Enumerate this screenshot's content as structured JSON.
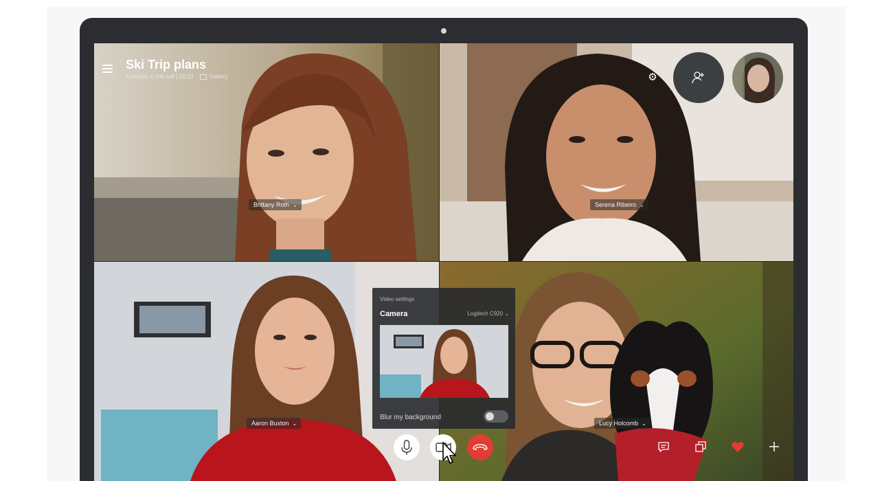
{
  "call": {
    "title": "Ski Trip plans",
    "participants_text": "3 people in the call",
    "separator": "|",
    "duration": "02:21",
    "view_mode": "Gallery"
  },
  "participants": [
    {
      "name": "Brittany Roth"
    },
    {
      "name": "Serena Ribeiro"
    },
    {
      "name": "Aaron Buxton"
    },
    {
      "name": "Lucy Holcomb"
    }
  ],
  "video_settings": {
    "heading": "Video settings",
    "camera_label": "Camera",
    "camera_device": "Logitech C920",
    "blur_label": "Blur my background",
    "blur_enabled": false
  },
  "controls": {
    "mic": "microphone-icon",
    "video": "video-camera-icon",
    "end_call": "hang-up-icon",
    "chat": "chat-icon",
    "share": "share-screen-icon",
    "react": "heart-icon",
    "more": "plus-icon"
  },
  "colors": {
    "end_call": "#e23d32",
    "heart": "#e23d32",
    "device_frame": "#2b2d31"
  }
}
